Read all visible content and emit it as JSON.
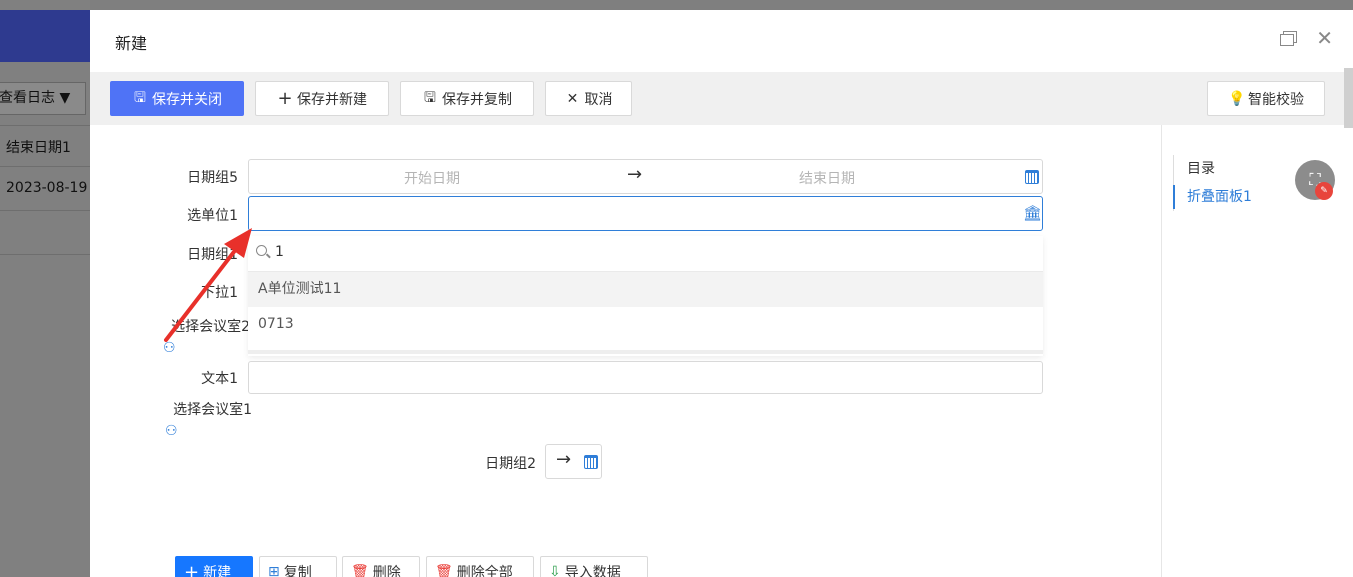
{
  "background": {
    "log_button": "查看日志 ▼",
    "col_header": "结束日期1",
    "col_value": "2023-08-19"
  },
  "dialog": {
    "title": "新建"
  },
  "toolbar": {
    "save_close": "保存并关闭",
    "save_new": "保存并新建",
    "save_copy": "保存并复制",
    "cancel": "取消",
    "smart_check": "智能校验"
  },
  "form": {
    "date_group5_label": "日期组5",
    "start_date_placeholder": "开始日期",
    "end_date_placeholder": "结束日期",
    "select_unit1_label": "选单位1",
    "date_group_hidden_label": "日期组1",
    "unit_hidden_label": "下拉1",
    "select_meeting2_label": "选择会议室2",
    "text1_label": "文本1",
    "select_meeting1_label": "选择会议室1",
    "date_group2_label": "日期组2"
  },
  "dropdown": {
    "search_value": "1",
    "items": [
      "A单位测试11",
      "0713"
    ]
  },
  "toc": {
    "title": "目录",
    "items": [
      "折叠面板1"
    ]
  },
  "subtable_toolbar": {
    "new": "新建",
    "copy": "复制",
    "delete": "删除",
    "delete_all": "删除全部",
    "import": "导入数据"
  },
  "colors": {
    "primary": "#4f73f6",
    "link": "#2f7ed8",
    "header_bg": "#2e3a8f",
    "annotation": "#e8302a"
  }
}
